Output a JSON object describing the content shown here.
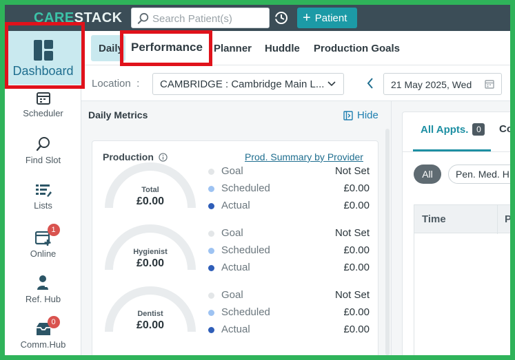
{
  "app": {
    "logo_care": "CARE",
    "logo_stack": "STACK"
  },
  "topbar": {
    "search_placeholder": "Search Patient(s)",
    "patient_button": "Patient"
  },
  "sidebar": {
    "items": [
      {
        "label": "Dashboard",
        "icon": "dashboard-icon"
      },
      {
        "label": "Scheduler",
        "icon": "calendar-icon"
      },
      {
        "label": "Find Slot",
        "icon": "search-icon"
      },
      {
        "label": "Lists",
        "icon": "list-icon"
      },
      {
        "label": "Online",
        "icon": "calendar-plus-icon",
        "badge": "1"
      },
      {
        "label": "Ref. Hub",
        "icon": "person-share-icon"
      },
      {
        "label": "Comm.Hub",
        "icon": "inbox-icon",
        "badge": "0"
      }
    ]
  },
  "tabs": {
    "daily": "Daily",
    "performance": "Performance",
    "planner": "Planner",
    "huddle": "Huddle",
    "production_goals": "Production Goals"
  },
  "location": {
    "label": "Location",
    "colon": ":",
    "value": "CAMBRIDGE : Cambridge Main L...",
    "date": "21 May 2025, Wed"
  },
  "metrics": {
    "title": "Daily Metrics",
    "hide_label": "Hide",
    "card_title": "Production",
    "summary_link": "Prod. Summary by Provider",
    "gauges": [
      {
        "label": "Total",
        "value": "£0.00",
        "goal": "Not Set",
        "scheduled": "£0.00",
        "actual": "£0.00"
      },
      {
        "label": "Hygienist",
        "value": "£0.00",
        "goal": "Not Set",
        "scheduled": "£0.00",
        "actual": "£0.00"
      },
      {
        "label": "Dentist",
        "value": "£0.00",
        "goal": "Not Set",
        "scheduled": "£0.00",
        "actual": "£0.00"
      }
    ],
    "legend": {
      "goal": "Goal",
      "scheduled": "Scheduled",
      "actual": "Actual"
    },
    "colors": {
      "goal": "#e3e6e8",
      "scheduled": "#9ec3f2",
      "actual": "#2f5eb8"
    }
  },
  "appointments": {
    "tab_all": "All Appts.",
    "tab_all_count": "0",
    "tab_second": "Co",
    "filter_all": "All",
    "filter_second": "Pen. Med. H",
    "col_time": "Time",
    "col_second": "Pa"
  },
  "colors": {
    "highlight": "#e0121b",
    "frame": "#2fb35a",
    "accent": "#1d8fa3"
  }
}
